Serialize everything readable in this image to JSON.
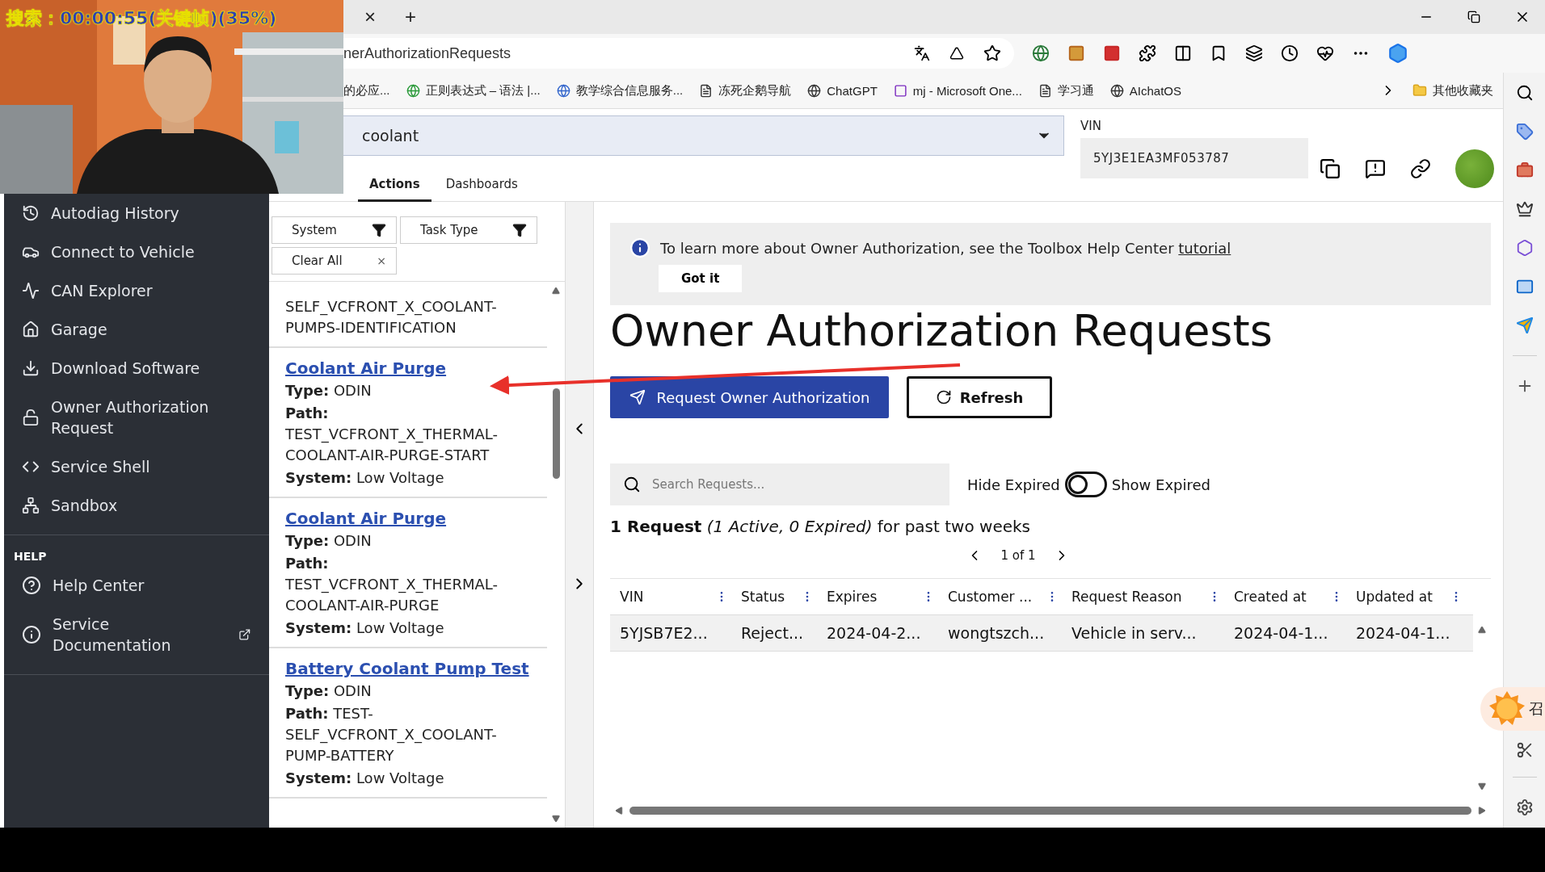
{
  "video_overlay": {
    "text": "搜索：00:00:55(关键帧)(35%)"
  },
  "browser": {
    "tab_close": "×",
    "new_tab": "+",
    "url": "nerAuthorizationRequests",
    "bookmarks": [
      {
        "label": "的必应..."
      },
      {
        "label": "正则表达式 – 语法 |..."
      },
      {
        "label": "教学综合信息服务..."
      },
      {
        "label": "冻死企鹅导航"
      },
      {
        "label": "ChatGPT"
      },
      {
        "label": "mj - Microsoft One..."
      },
      {
        "label": "学习通"
      },
      {
        "label": "AIchatOS"
      }
    ],
    "more_bookmarks": "其他收藏夹",
    "widget_label": "召"
  },
  "header": {
    "search_value": "coolant",
    "vin_label": "VIN",
    "vin": "5YJ3E1EA3MF053787",
    "tabs": [
      {
        "label": "Actions",
        "selected": true
      },
      {
        "label": "Dashboards",
        "selected": false
      }
    ]
  },
  "sidebar": {
    "items": [
      {
        "label": "Autodiag History"
      },
      {
        "label": "Connect to Vehicle"
      },
      {
        "label": "CAN Explorer"
      },
      {
        "label": "Garage"
      },
      {
        "label": "Download Software"
      },
      {
        "label": "Owner Authorization Request"
      },
      {
        "label": "Service Shell"
      },
      {
        "label": "Sandbox"
      }
    ],
    "help_heading": "HELP",
    "help_items": [
      {
        "label": "Help Center"
      },
      {
        "label": "Service Documentation"
      }
    ]
  },
  "actions": {
    "filters": [
      {
        "label": "System"
      },
      {
        "label": "Task Type"
      }
    ],
    "clear_all": "Clear All",
    "clear_x": "×",
    "items": [
      {
        "kind": "partial",
        "path": "SELF_VCFRONT_X_COOLANT-PUMPS-IDENTIFICATION"
      },
      {
        "kind": "task",
        "title": "Coolant Air Purge",
        "type": "**Type:** ODIN",
        "path": "**Path:** TEST_VCFRONT_X_THERMAL-COOLANT-AIR-PURGE-START",
        "system": "**System:** Low Voltage"
      },
      {
        "kind": "task",
        "title": "Coolant Air Purge",
        "type": "**Type:** ODIN",
        "path": "**Path:** TEST_VCFRONT_X_THERMAL-COOLANT-AIR-PURGE",
        "system": "**System:** Low Voltage"
      },
      {
        "kind": "task",
        "title": "Battery Coolant Pump Test",
        "type": "**Type:** ODIN",
        "path": "**Path:** TEST-SELF_VCFRONT_X_COOLANT-PUMP-BATTERY",
        "system": "**System:** Low Voltage"
      }
    ]
  },
  "main": {
    "notice": "To learn more about Owner Authorization, see the Toolbox Help Center",
    "notice_link": "tutorial",
    "got_it": "Got it",
    "title": "Owner Authorization Requests",
    "request_button": "Request Owner Authorization",
    "refresh_button": "Refresh",
    "search_placeholder": "Search Requests...",
    "toggle": {
      "left": "Hide Expired",
      "right": "Show Expired",
      "on": false
    },
    "summary": "**1 Request** *(1 Active, 0 Expired)* for past two weeks",
    "pager": "1 of 1",
    "table": {
      "columns": [
        "VIN",
        "Status",
        "Expires",
        "Customer ...",
        "Request Reason",
        "Created at",
        "Updated at"
      ],
      "rows": [
        [
          "5YJSB7E2...",
          "Reject...",
          "2024-04-2...",
          "wongtszch...",
          "Vehicle in serv...",
          "2024-04-1...",
          "2024-04-1..."
        ]
      ]
    }
  }
}
